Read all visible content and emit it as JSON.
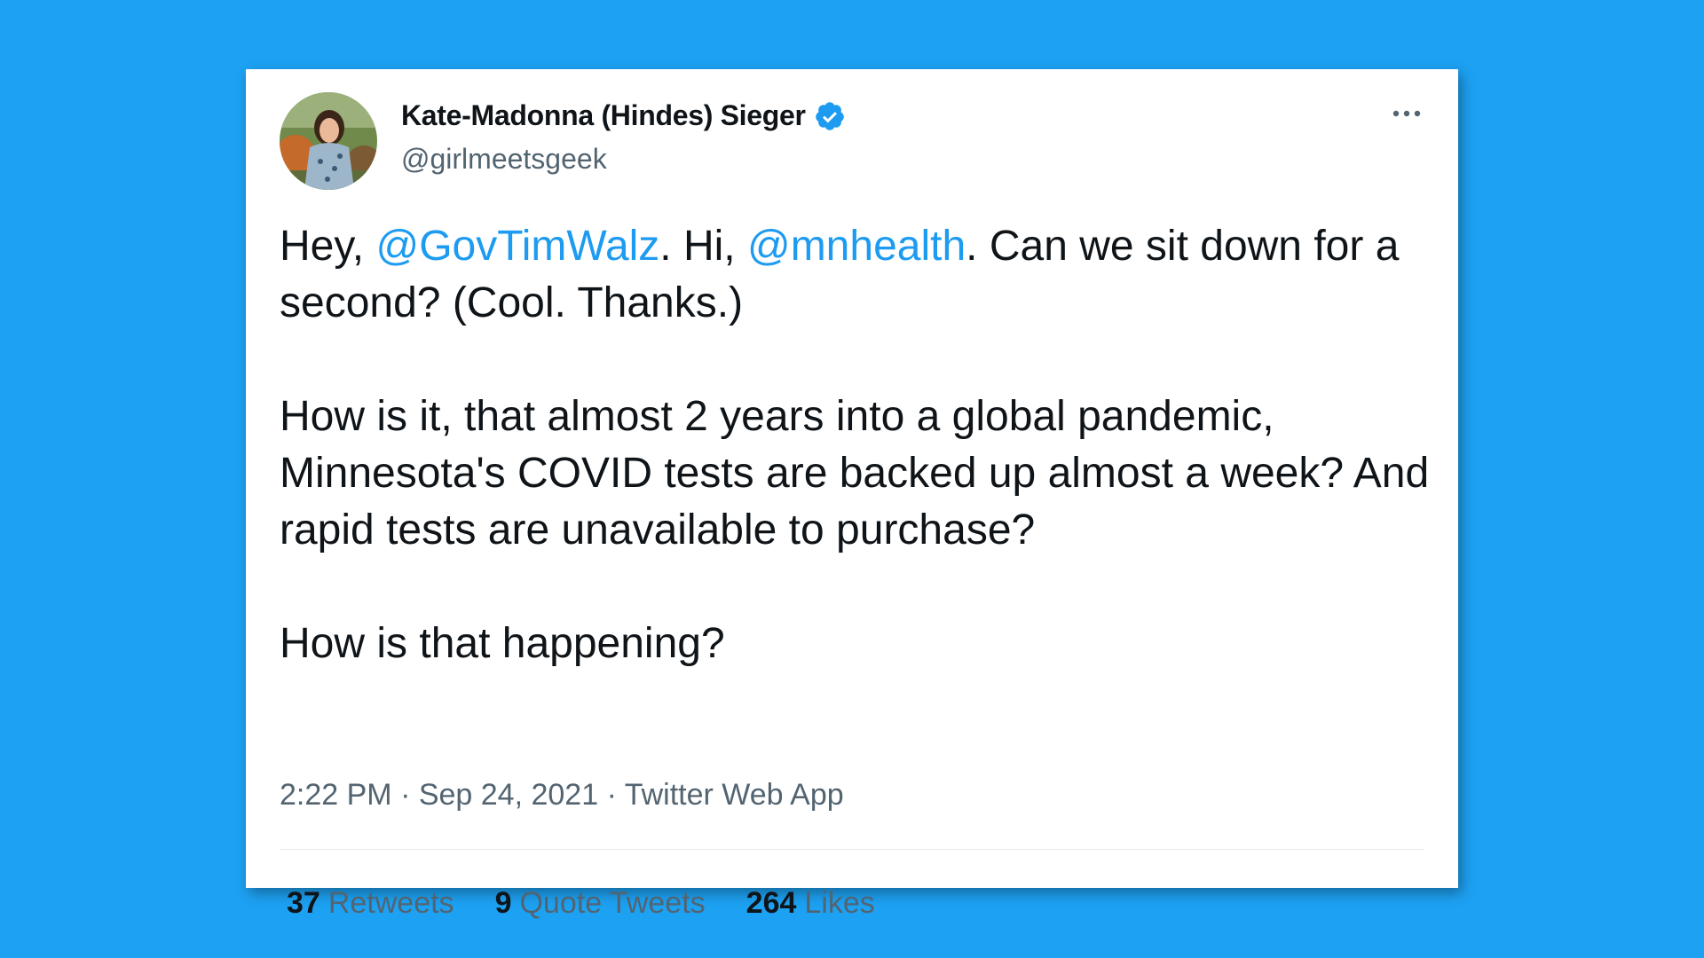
{
  "tweet": {
    "author": {
      "display_name": "Kate-Madonna (Hindes) Sieger",
      "handle": "@girlmeetsgeek",
      "verified": true
    },
    "text": {
      "p1_a": "Hey, ",
      "mention_1": "@GovTimWalz",
      "p1_b": ". Hi, ",
      "mention_2": "@mnhealth",
      "p1_c": ". Can we sit down for a second? (Cool. Thanks.)",
      "p2": "How is it, that almost 2 years into a global pandemic, Minnesota's COVID tests are backed up almost a week? And rapid tests are unavailable to purchase?",
      "p3": "How is that happening?"
    },
    "meta": "2:22 PM · Sep 24, 2021 · Twitter Web App",
    "stats": {
      "retweets_count": "37",
      "retweets_label": "Retweets",
      "quotes_count": "9",
      "quotes_label": "Quote Tweets",
      "likes_count": "264",
      "likes_label": "Likes"
    }
  },
  "icons": {
    "verified": "verified-badge-icon",
    "more": "more-options-icon"
  },
  "colors": {
    "background": "#1da1f2",
    "link": "#1d9bf0",
    "text": "#0f1419",
    "secondary": "#536471",
    "verified": "#1d9bf0"
  }
}
